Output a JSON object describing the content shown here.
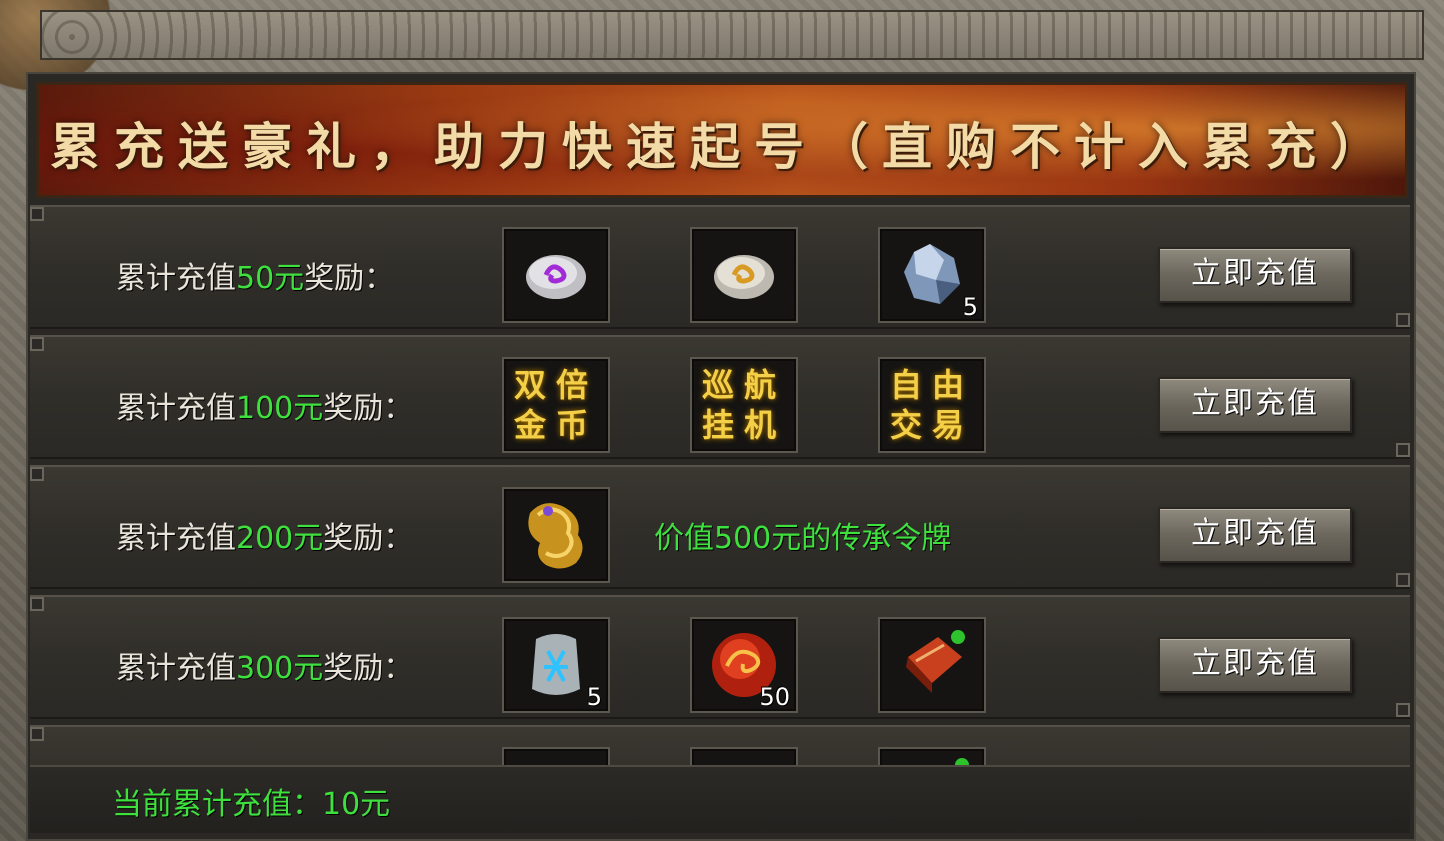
{
  "banner": {
    "title": "累充送豪礼，助力快速起号（直购不计入累充）"
  },
  "rows": [
    {
      "label_prefix": "累计充值",
      "amount": "50元",
      "label_suffix": "奖励：",
      "button": "立即充值",
      "items": [
        {
          "icon": "purple-rune-stone-icon",
          "count": ""
        },
        {
          "icon": "gold-rune-stone-icon",
          "count": ""
        },
        {
          "icon": "blue-ore-icon",
          "count": "5"
        }
      ]
    },
    {
      "label_prefix": "累计充值",
      "amount": "100元",
      "label_suffix": "奖励：",
      "button": "立即充值",
      "items": [
        {
          "icon": "double-gold-icon",
          "text": "双倍金币"
        },
        {
          "icon": "auto-cruise-icon",
          "text": "巡航挂机"
        },
        {
          "icon": "free-trade-icon",
          "text": "自由交易"
        }
      ]
    },
    {
      "label_prefix": "累计充值",
      "amount": "200元",
      "label_suffix": "奖励：",
      "button": "立即充值",
      "items": [
        {
          "icon": "golden-dragon-token-icon",
          "count": ""
        }
      ],
      "description": "价值500元的传承令牌"
    },
    {
      "label_prefix": "累计充值",
      "amount": "300元",
      "label_suffix": "奖励：",
      "button": "立即充值",
      "items": [
        {
          "icon": "blue-rune-tablet-icon",
          "count": "5"
        },
        {
          "icon": "red-dragon-orb-icon",
          "count": "50"
        },
        {
          "icon": "red-book-icon",
          "count": ""
        }
      ]
    }
  ],
  "footer": {
    "current_total": "当前累计充值：10元"
  },
  "colors": {
    "amount": "#3ee03e",
    "banner_text": "#f2dba6",
    "gold_text": "#f4cf48"
  }
}
